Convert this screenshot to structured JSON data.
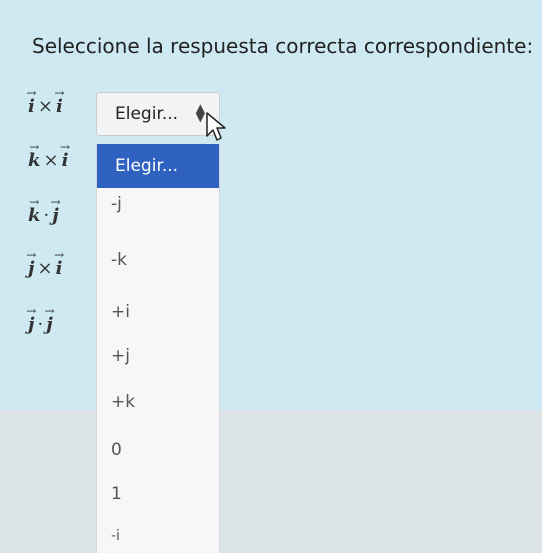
{
  "question": {
    "prompt": "Seleccione la respuesta correcta correspondiente:"
  },
  "expressions": [
    {
      "left": "i",
      "op": "×",
      "right": "i"
    },
    {
      "left": "k",
      "op": "×",
      "right": "i"
    },
    {
      "left": "k",
      "op": "·",
      "right": "j"
    },
    {
      "left": "j",
      "op": "×",
      "right": "i"
    },
    {
      "left": "j",
      "op": "·",
      "right": "j"
    }
  ],
  "select": {
    "value": "Elegir...",
    "caret_icon": "updown-caret-icon"
  },
  "dropdown": {
    "options": [
      "Elegir...",
      "-j",
      "-k",
      "+i",
      "+j",
      "+k",
      "0",
      "1",
      "-i"
    ],
    "highlighted": "Elegir..."
  },
  "colors": {
    "panel": "#cfe9f3",
    "highlight": "#2f62c0"
  }
}
